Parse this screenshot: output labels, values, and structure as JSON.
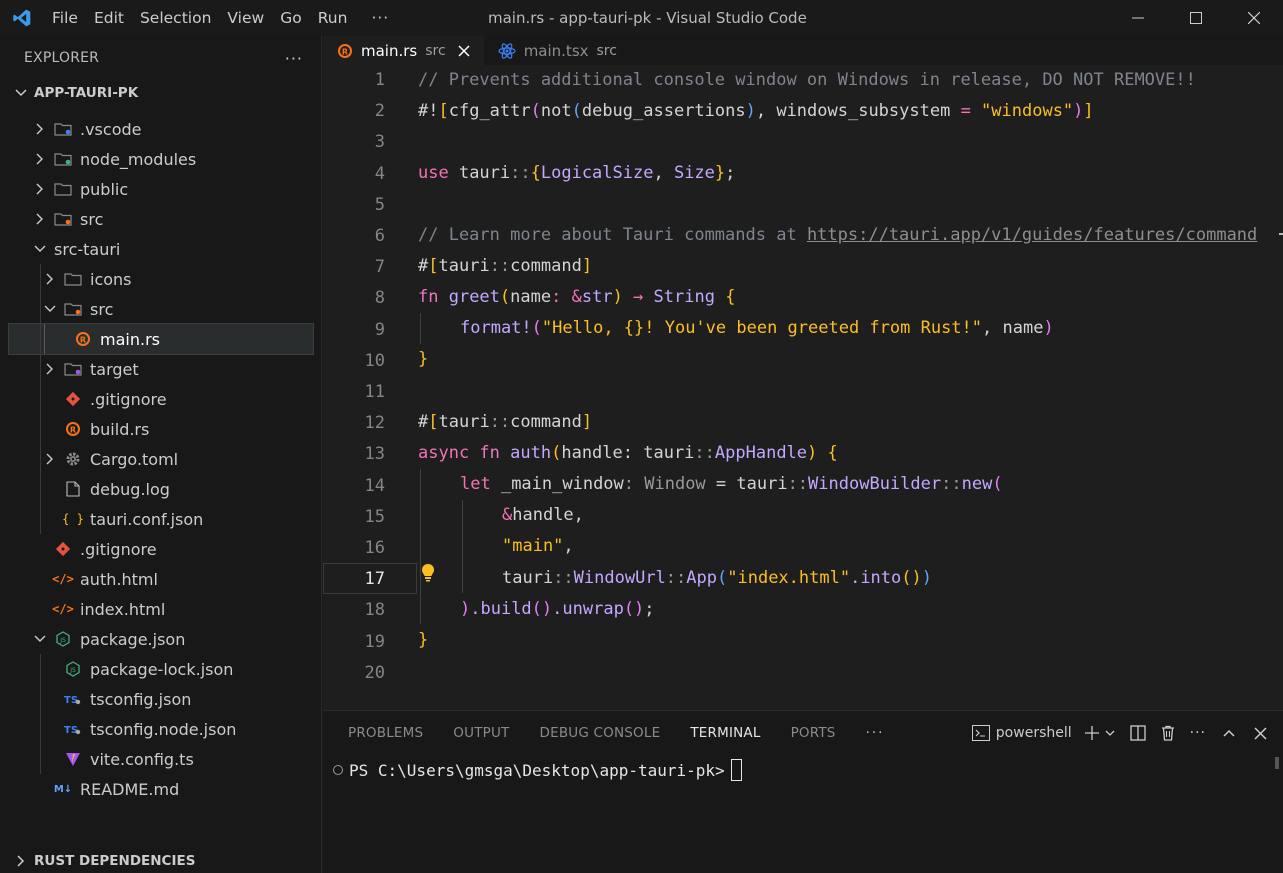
{
  "titlebar": {
    "menu": [
      "File",
      "Edit",
      "Selection",
      "View",
      "Go",
      "Run"
    ],
    "overflow": "···",
    "window_title": "main.rs - app-tauri-pk - Visual Studio Code"
  },
  "sidebar": {
    "title": "EXPLORER",
    "more": "···",
    "project": "APP-TAURI-PK",
    "items": [
      {
        "label": ".vscode"
      },
      {
        "label": "node_modules"
      },
      {
        "label": "public"
      },
      {
        "label": "src"
      },
      {
        "label": "src-tauri"
      },
      {
        "label": "icons"
      },
      {
        "label": "src"
      },
      {
        "label": "main.rs"
      },
      {
        "label": "target"
      },
      {
        "label": ".gitignore"
      },
      {
        "label": "build.rs"
      },
      {
        "label": "Cargo.toml"
      },
      {
        "label": "debug.log"
      },
      {
        "label": "tauri.conf.json"
      },
      {
        "label": ".gitignore"
      },
      {
        "label": "auth.html"
      },
      {
        "label": "index.html"
      },
      {
        "label": "package.json"
      },
      {
        "label": "package-lock.json"
      },
      {
        "label": "tsconfig.json"
      },
      {
        "label": "tsconfig.node.json"
      },
      {
        "label": "vite.config.ts"
      },
      {
        "label": "README.md"
      }
    ],
    "rust_deps": "RUST DEPENDENCIES"
  },
  "tabs": [
    {
      "name": "main.rs",
      "desc": "src"
    },
    {
      "name": "main.tsx",
      "desc": "src"
    }
  ],
  "editor": {
    "line_numbers": [
      "1",
      "2",
      "3",
      "4",
      "5",
      "6",
      "7",
      "8",
      "9",
      "10",
      "11",
      "12",
      "13",
      "14",
      "15",
      "16",
      "17",
      "18",
      "19",
      "20"
    ],
    "current_line": "17",
    "code": {
      "l1": "// Prevents additional console window on Windows in release, DO NOT REMOVE!!",
      "l2a": "#!",
      "l2b": "[",
      "l2c": "cfg_attr",
      "l2d": "(",
      "l2e": "not",
      "l2f": "(",
      "l2g": "debug_assertions",
      "l2h": ")",
      "l2i": ", windows_subsystem ",
      "l2j": "=",
      "l2k": " \"windows\"",
      "l2l": ")",
      "l2m": "]",
      "l4a": "use",
      "l4b": " tauri",
      "l4c": "::",
      "l4d": "{",
      "l4e": "LogicalSize",
      "l4f": ", ",
      "l4g": "Size",
      "l4h": "}",
      "l4i": ";",
      "l6a": "// Learn more about Tauri commands at ",
      "l6b": "https://tauri.app/v1/guides/features/command",
      "l7a": "#",
      "l7b": "[",
      "l7c": "tauri",
      "l7d": "::",
      "l7e": "command",
      "l7f": "]",
      "l8a": "fn",
      "l8b": " greet",
      "l8c": "(",
      "l8d": "name",
      "l8e": ": ",
      "l8f": "&",
      "l8g": "str",
      "l8h": ")",
      "l8i": " → ",
      "l8j": "String",
      "l8k": " {",
      "l9a": "format!",
      "l9b": "(",
      "l9c": "\"Hello, {}! You've been greeted from Rust!\"",
      "l9d": ", name",
      "l9e": ")",
      "l10": "}",
      "l12a": "#",
      "l12b": "[",
      "l12c": "tauri",
      "l12d": "::",
      "l12e": "command",
      "l12f": "]",
      "l13a": "async",
      "l13b": " fn",
      "l13c": " auth",
      "l13d": "(",
      "l13e": "handle",
      "l13f": ": tauri",
      "l13g": "::",
      "l13h": "AppHandle",
      "l13i": ")",
      "l13j": " {",
      "l14a": "let",
      "l14b": " _main_window",
      "l14c": ": Window",
      "l14d": " = tauri",
      "l14e": "::",
      "l14f": "WindowBuilder",
      "l14g": "::",
      "l14h": "new",
      "l14i": "(",
      "l15a": "&",
      "l15b": "handle,",
      "l16a": "\"main\"",
      "l16b": ",",
      "l17a": "tauri",
      "l17b": "::",
      "l17c": "WindowUrl",
      "l17d": "::",
      "l17e": "App",
      "l17f": "(",
      "l17g": "\"index.html\"",
      "l17h": ".into",
      "l17i": "()",
      "l17j": ")",
      "l18a": ")",
      "l18b": ".build",
      "l18c": "()",
      "l18d": ".unwrap",
      "l18e": "()",
      "l18f": ";",
      "l19": "}"
    }
  },
  "panel": {
    "tabs": [
      "PROBLEMS",
      "OUTPUT",
      "DEBUG CONSOLE",
      "TERMINAL",
      "PORTS"
    ],
    "overflow": "···",
    "shell": "powershell",
    "prompt": "PS C:\\Users\\gmsga\\Desktop\\app-tauri-pk>"
  },
  "colors": {
    "accent_blue": "#3b82f6",
    "rust_orange": "#f97316",
    "string_yellow": "#fbbf24",
    "keyword_pink": "#f472b6",
    "type_purple": "#c4a7ff"
  }
}
